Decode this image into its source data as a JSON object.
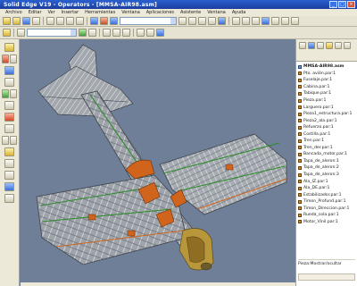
{
  "window": {
    "title": "Solid Edge V19 - Operators - [MMSA-AIR98.asm]"
  },
  "menu": [
    "Archivo",
    "Editar",
    "Ver",
    "Insertar",
    "Herramientas",
    "Ventana",
    "Aplicaciones",
    "Asistente",
    "Ventana",
    "Ayuda"
  ],
  "toolbar": {
    "combo1": "",
    "combo2": ""
  },
  "tree": {
    "root": "MMSA-AIR98.asm",
    "items": [
      "Pto. avión.par:1",
      "Fuselaje.par:1",
      "Cabina.par:1",
      "Tabique.par:1",
      "Pieza.par:1",
      "Larguero.par:1",
      "Pieza1_estructura.par:1",
      "Pieza2_ala.par:1",
      "Refuerzo.par:1",
      "Costilla.par:1",
      "Tren.par:1",
      "Tren_der.par:1",
      "Bancada_motor.par:1",
      "Tapa_de_aleron:1",
      "Tapa_de_aleron:2",
      "Tapa_de_aleron:3",
      "Ala_IZ.par:1",
      "Ala_DE.par:1",
      "Estabilizador.par:1",
      "Timon_Profund.par:1",
      "Timon_Direccion.par:1",
      "Rueda_cola.par:1",
      "Motor_Vinil.par:1"
    ],
    "footer": "Pieza:Mostrar/ocultar"
  },
  "colors": {
    "viewport": "#6f7f98",
    "frame": "#bdbdbd",
    "accent": "#d0641c"
  }
}
